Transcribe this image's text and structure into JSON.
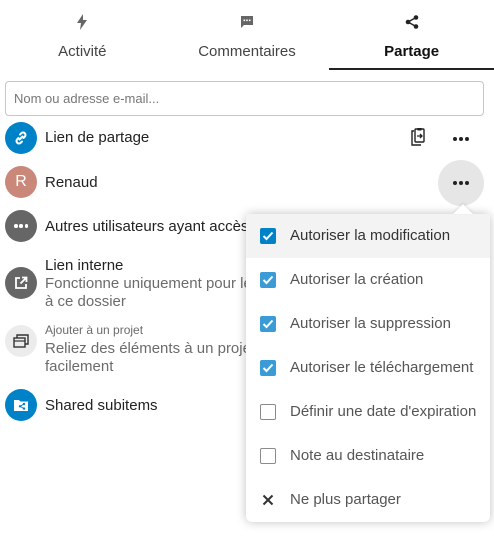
{
  "tabs": [
    {
      "label": "Activité",
      "icon": "lightning-icon"
    },
    {
      "label": "Commentaires",
      "icon": "comment-icon"
    },
    {
      "label": "Partage",
      "icon": "share-icon",
      "active": true
    }
  ],
  "search": {
    "placeholder": "Nom ou adresse e-mail..."
  },
  "shares": {
    "link": {
      "title": "Lien de partage"
    },
    "renaud": {
      "initial": "R",
      "title": "Renaud"
    },
    "others": {
      "title": "Autres utilisateurs ayant accès"
    },
    "internal": {
      "title": "Lien interne",
      "sub1": "Fonctionne uniquement pour le",
      "sub2": "à ce dossier"
    },
    "project": {
      "small": "Ajouter à un projet",
      "sub1": "Reliez des éléments à un projet",
      "sub2": "facilement"
    },
    "subitems": {
      "title": "Shared subitems"
    }
  },
  "menu": {
    "items": [
      {
        "label": "Autoriser la modification",
        "checked": true
      },
      {
        "label": "Autoriser la création",
        "checked": true
      },
      {
        "label": "Autoriser la suppression",
        "checked": true
      },
      {
        "label": "Autoriser le téléchargement",
        "checked": true
      },
      {
        "label": "Définir une date d'expiration",
        "checked": false
      },
      {
        "label": "Note au destinataire",
        "checked": false
      },
      {
        "label": "Ne plus partager",
        "icon": "close-icon"
      }
    ]
  },
  "colors": {
    "accent": "#0082c9",
    "avatar_renaud": "#c98879",
    "grey_icon": "#666666"
  }
}
